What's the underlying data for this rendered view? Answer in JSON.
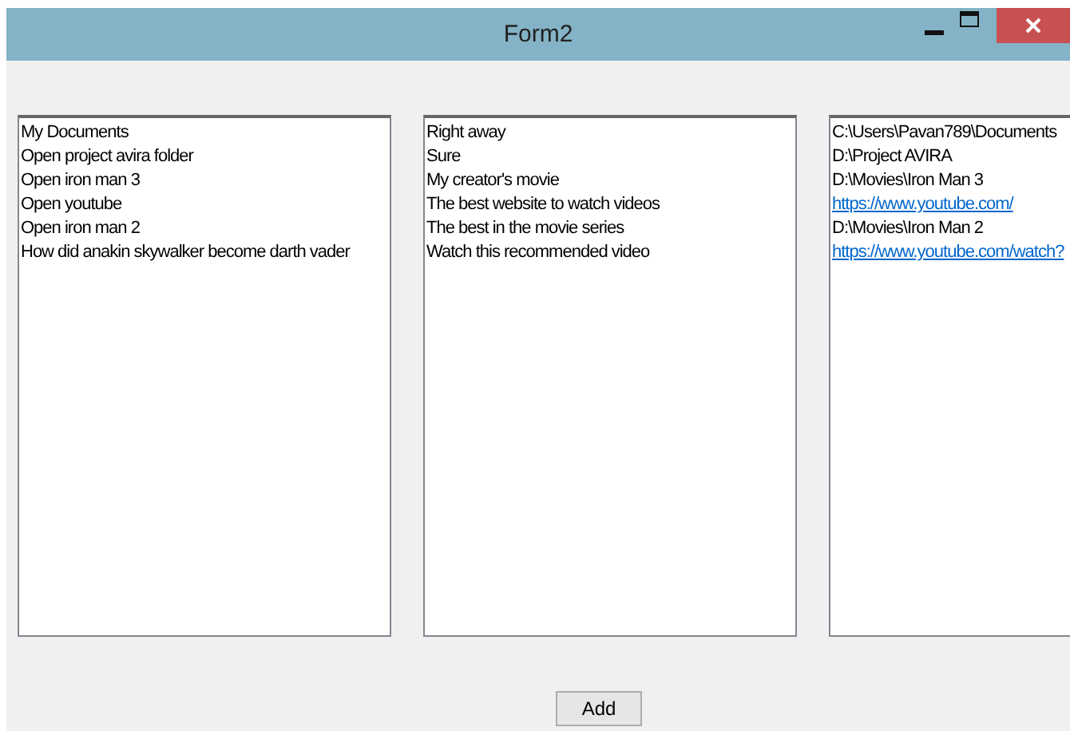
{
  "window": {
    "title": "Form2"
  },
  "lists": [
    {
      "items": [
        {
          "kind": "text",
          "text": "My Documents"
        },
        {
          "kind": "text",
          "text": "Open project avira folder"
        },
        {
          "kind": "text",
          "text": "Open iron man 3"
        },
        {
          "kind": "text",
          "text": "Open youtube"
        },
        {
          "kind": "text",
          "text": "Open iron man 2"
        },
        {
          "kind": "text",
          "text": "How did anakin skywalker become darth vader"
        }
      ]
    },
    {
      "items": [
        {
          "kind": "text",
          "text": "Right away"
        },
        {
          "kind": "text",
          "text": "Sure"
        },
        {
          "kind": "text",
          "text": "My creator's movie"
        },
        {
          "kind": "text",
          "text": "The best website to watch videos"
        },
        {
          "kind": "text",
          "text": "The best in the movie series"
        },
        {
          "kind": "text",
          "text": "Watch this recommended video"
        }
      ]
    },
    {
      "items": [
        {
          "kind": "text",
          "text": "C:\\Users\\Pavan789\\Documents"
        },
        {
          "kind": "text",
          "text": "D:\\Project AVIRA"
        },
        {
          "kind": "text",
          "text": "D:\\Movies\\Iron Man 3"
        },
        {
          "kind": "link",
          "text": "https://www.youtube.com/"
        },
        {
          "kind": "text",
          "text": "D:\\Movies\\Iron Man 2"
        },
        {
          "kind": "link",
          "text": "https://www.youtube.com/watch?"
        }
      ]
    }
  ],
  "button": "Add"
}
